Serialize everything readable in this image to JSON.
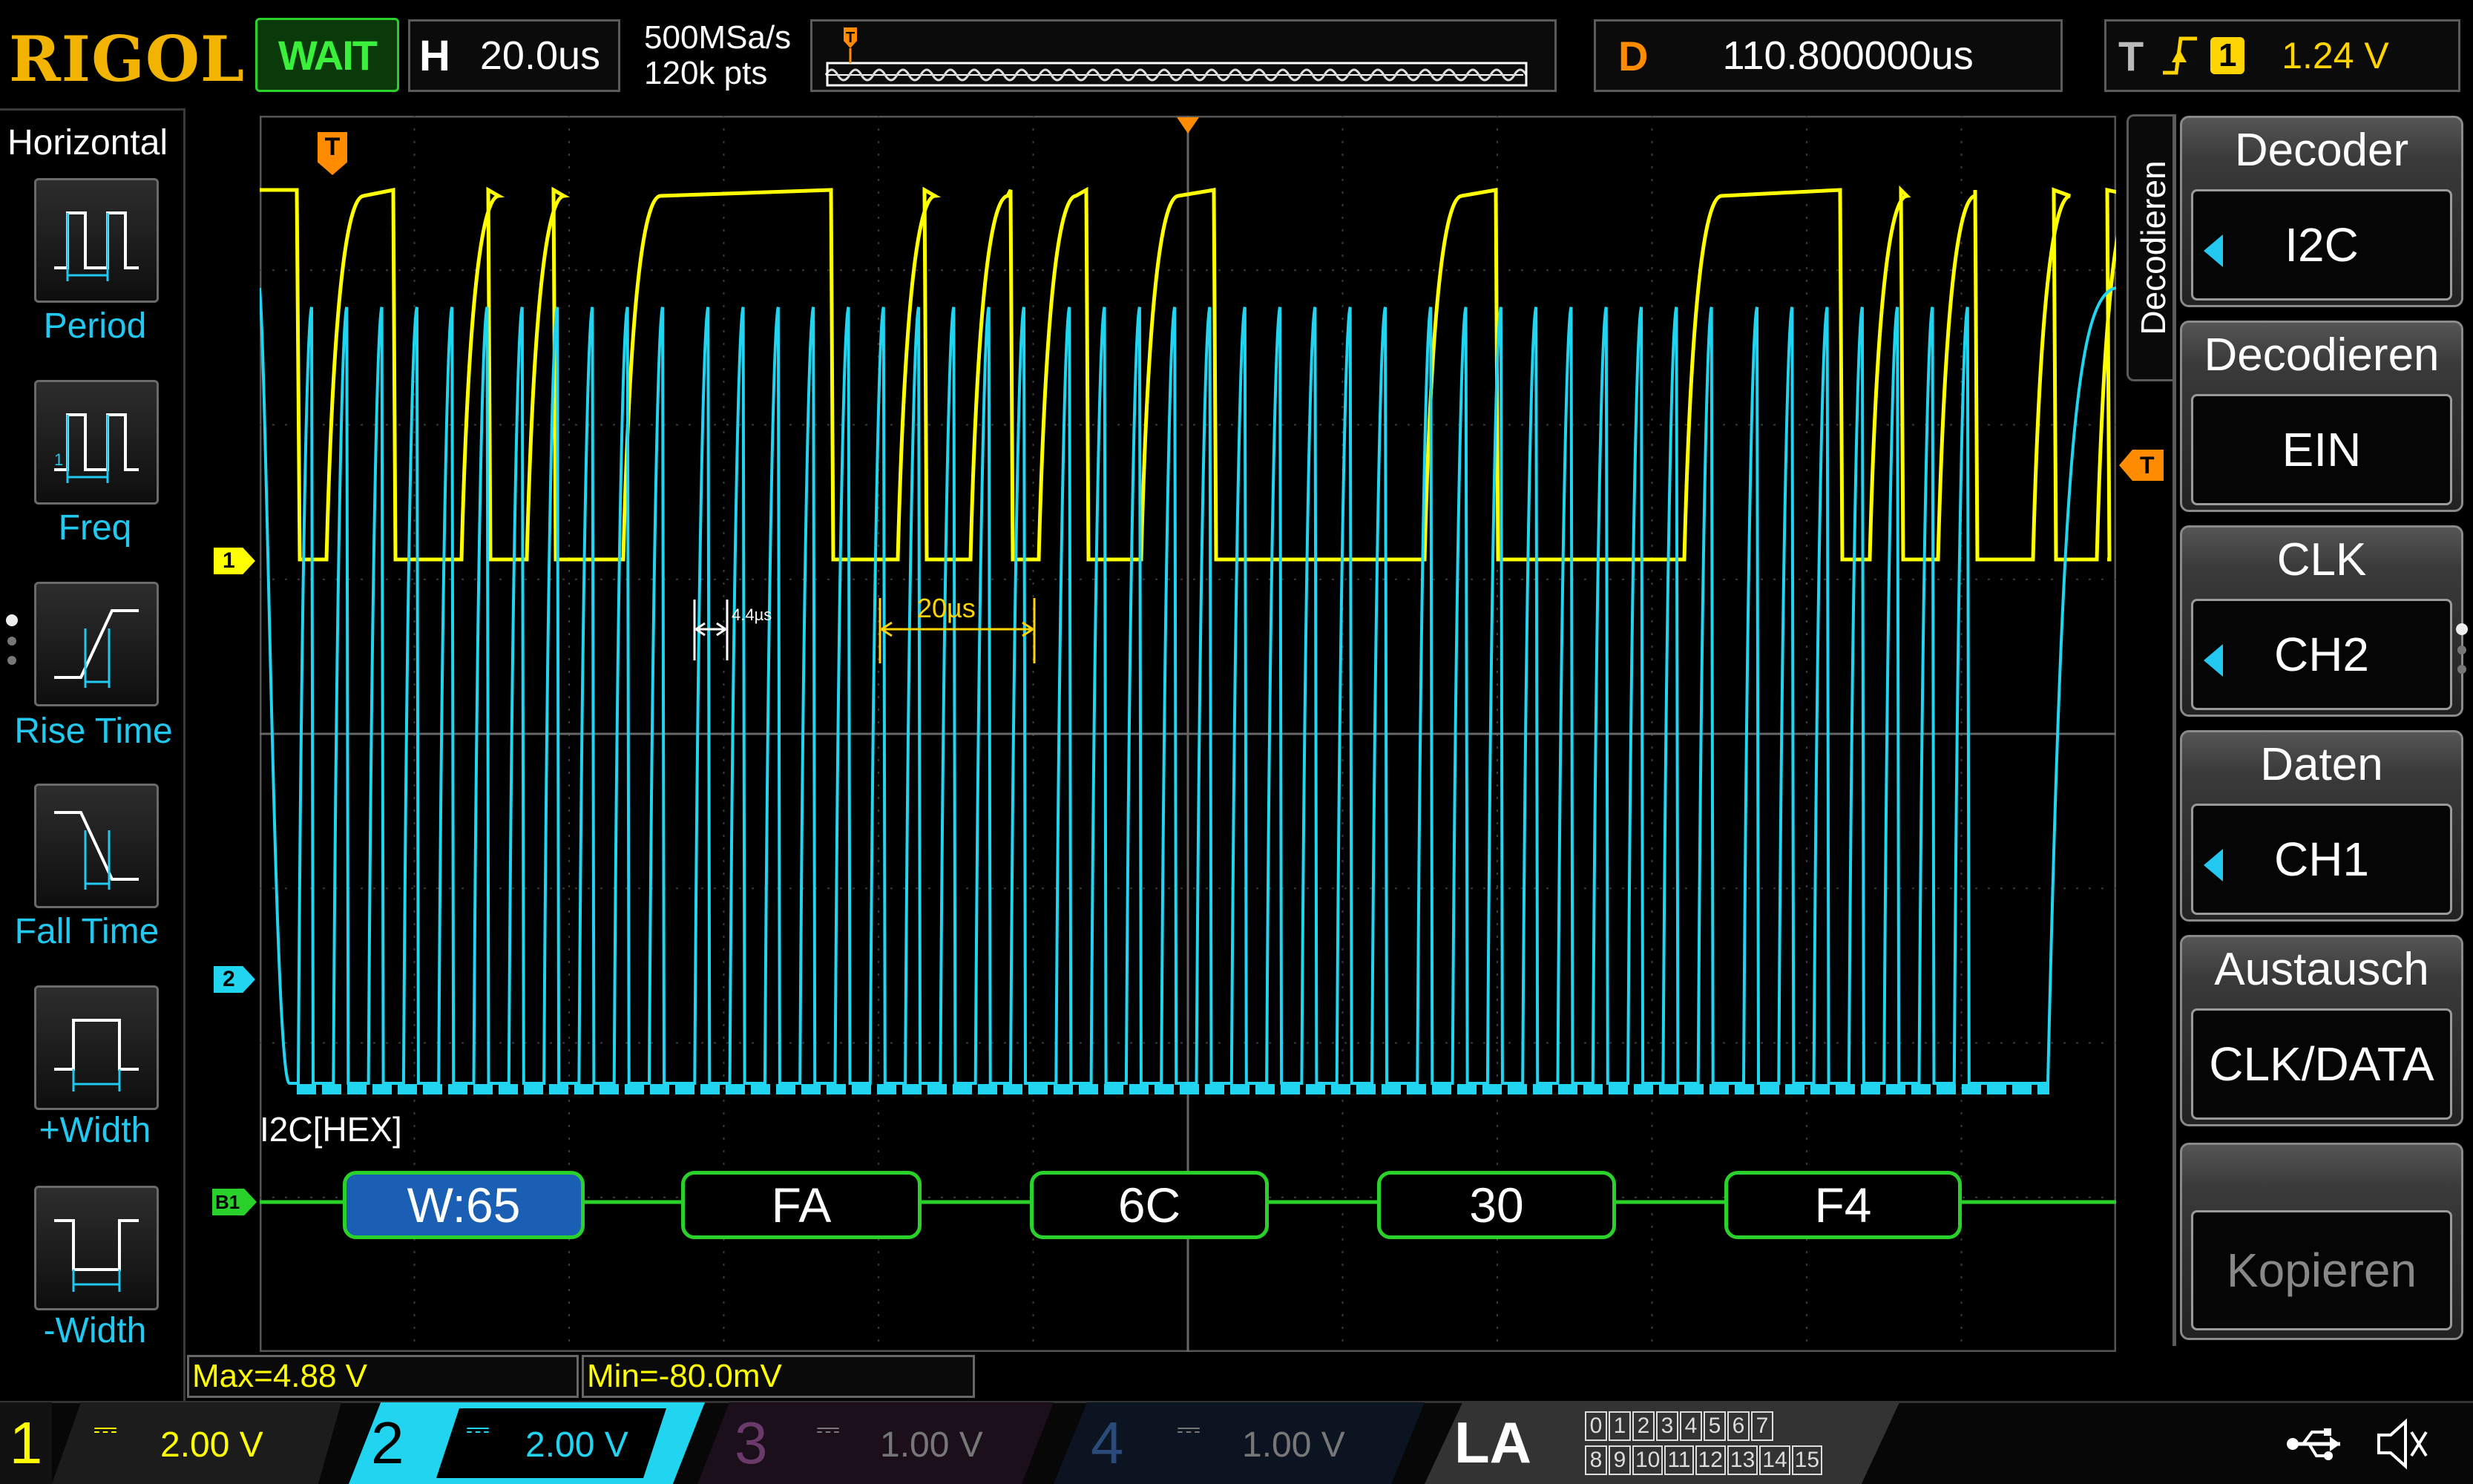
{
  "header": {
    "brand": "RIGOL",
    "run_state": "WAIT",
    "timebase_label": "H",
    "timebase_value": "20.0us",
    "sample_rate": "500MSa/s",
    "memory_depth": "120k pts",
    "delay_label": "D",
    "delay_value": "110.800000us",
    "trigger_label": "T",
    "trigger_source": "1",
    "trigger_level": "1.24 V"
  },
  "left_menu": {
    "title": "Horizontal",
    "items": [
      {
        "label": "Period",
        "icon": "period-icon"
      },
      {
        "label": "Freq",
        "icon": "frequency-icon"
      },
      {
        "label": "Rise Time",
        "icon": "rise-time-icon"
      },
      {
        "label": "Fall Time",
        "icon": "fall-time-icon"
      },
      {
        "label": "+Width",
        "icon": "positive-width-icon"
      },
      {
        "label": "-Width",
        "icon": "negative-width-icon"
      }
    ]
  },
  "right_menu": {
    "tab_label": "Decodieren",
    "items": [
      {
        "title": "Decoder",
        "value": "I2C"
      },
      {
        "title": "Decodieren",
        "value": "EIN"
      },
      {
        "title": "CLK",
        "value": "CH2"
      },
      {
        "title": "Daten",
        "value": "CH1"
      },
      {
        "title": "Austausch",
        "value": "CLK/DATA"
      },
      {
        "title": "",
        "value": "Kopieren"
      }
    ]
  },
  "waveform": {
    "ch1_marker": "1",
    "ch2_marker": "2",
    "trigger_marker": "T",
    "cursor_small_label": "4.4µs",
    "cursor_big_label": "20µs",
    "bus_label": "I2C[HEX]",
    "bus_marker": "B1",
    "decoded_bytes": [
      "W:65",
      "FA",
      "6C",
      "30",
      "F4"
    ]
  },
  "measurements": {
    "max": "Max=4.88 V",
    "min": "Min=-80.0mV"
  },
  "channels": [
    {
      "number": "1",
      "coupling": "⎓",
      "scale": "2.00 V",
      "color": "#ffff00"
    },
    {
      "number": "2",
      "coupling": "⎓",
      "scale": "2.00 V",
      "color": "#21d4f0"
    },
    {
      "number": "3",
      "coupling": "⎓",
      "scale": "1.00 V",
      "color": "#8a3a8a"
    },
    {
      "number": "4",
      "coupling": "⎓",
      "scale": "1.00 V",
      "color": "#2a5a9a"
    }
  ],
  "logic_analyzer": {
    "label": "LA",
    "bits_row1": [
      "0",
      "1",
      "2",
      "3",
      "4",
      "5",
      "6",
      "7"
    ],
    "bits_row2": [
      "8",
      "9",
      "10",
      "11",
      "12",
      "13",
      "14",
      "15"
    ]
  },
  "status_icons": [
    "usb-icon",
    "speaker-muted-icon"
  ],
  "colors": {
    "ch1": "#ffff00",
    "ch2": "#21d4f0",
    "decode": "#2bd12b",
    "highlight": "#1a5fb4",
    "trigger": "#ff8c00",
    "accent_cyan": "#21c8f0"
  }
}
